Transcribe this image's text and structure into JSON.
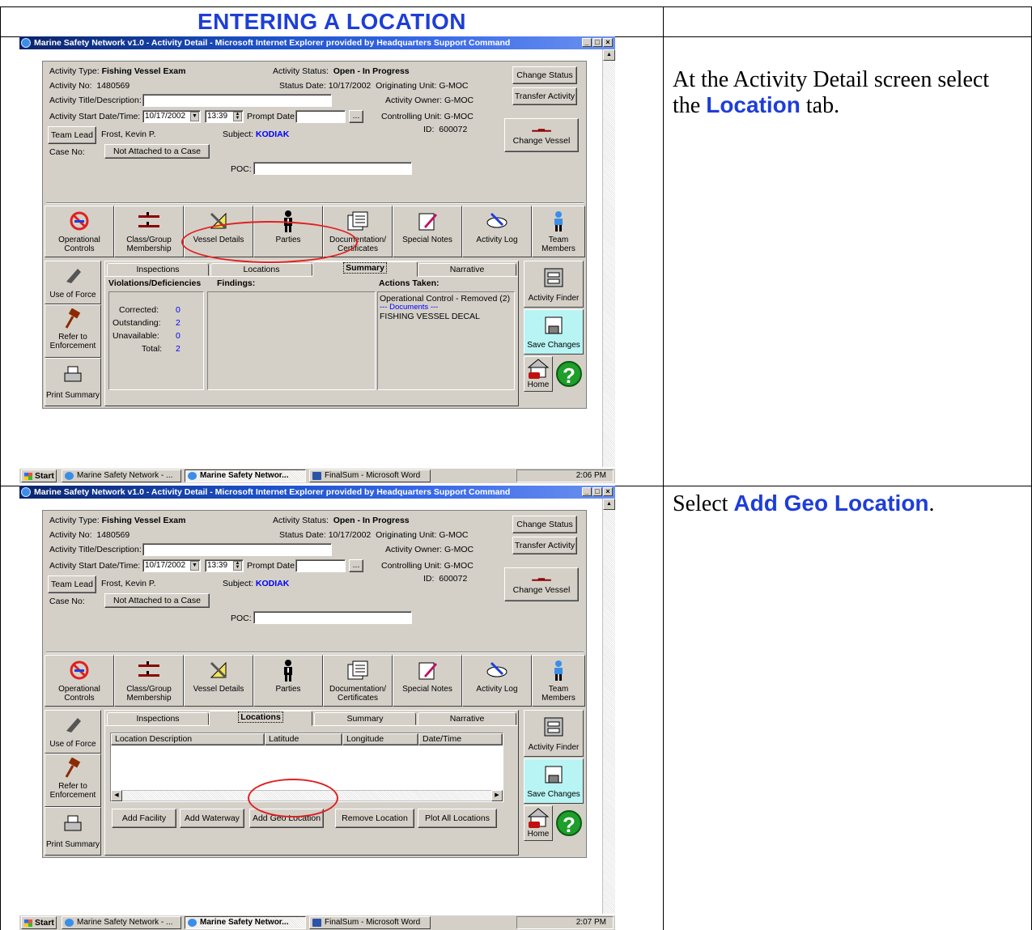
{
  "doc": {
    "header_title": "ENTERING A LOCATION",
    "step1": {
      "pre": "At the Activity Detail screen select the ",
      "highlight": "Location",
      "post": " tab."
    },
    "step2": {
      "pre": "Select ",
      "highlight": "Add Geo Location",
      "post": "."
    }
  },
  "window": {
    "title": "Marine Safety Network v1.0 - Activity Detail - Microsoft Internet Explorer provided by Headquarters Support Command",
    "minimize": "_",
    "maximize": "□",
    "close": "×"
  },
  "form": {
    "activity_type_label": "Activity Type:",
    "activity_type": "Fishing Vessel Exam",
    "activity_no_label": "Activity No:",
    "activity_no": "1480569",
    "title_label": "Activity Title/Description:",
    "title_value": "",
    "start_label": "Activity Start Date/Time:",
    "start_date": "10/17/2002",
    "start_time": "13:39",
    "prompt_label": "Prompt Date:",
    "prompt_value": "",
    "team_lead_button": "Team Lead",
    "team_lead": "Frost, Kevin P.",
    "subject_label": "Subject:",
    "subject": "KODIAK",
    "case_label": "Case No:",
    "case_button": "Not Attached to a Case",
    "poc_label": "POC:",
    "poc_value": "",
    "status_label": "Activity Status:",
    "status": "Open - In Progress",
    "status_date_label": "Status Date:",
    "status_date": "10/17/2002",
    "orig_unit_label": "Originating Unit:",
    "orig_unit": "G-MOC",
    "owner_label": "Activity Owner:",
    "owner": "G-MOC",
    "ctrl_unit_label": "Controlling Unit:",
    "ctrl_unit": "G-MOC",
    "id_label": "ID:",
    "id": "600072",
    "change_status": "Change Status",
    "transfer_activity": "Transfer Activity",
    "change_vessel": "Change Vessel",
    "ellipsis": "..."
  },
  "iconbar": [
    {
      "l1": "Operational",
      "l2": "Controls",
      "icon": "no-entry-icon"
    },
    {
      "l1": "Class/Group",
      "l2": "Membership",
      "icon": "ships-icon"
    },
    {
      "l1": "Vessel Details",
      "l2": "",
      "icon": "tools-icon"
    },
    {
      "l1": "Parties",
      "l2": "",
      "icon": "person-icon"
    },
    {
      "l1": "Documentation/",
      "l2": "Certificates",
      "icon": "documents-icon"
    },
    {
      "l1": "Special Notes",
      "l2": "",
      "icon": "notes-icon"
    },
    {
      "l1": "Activity  Log",
      "l2": "",
      "icon": "log-icon"
    },
    {
      "l1": "Team Members",
      "l2": "",
      "icon": "sailor-icon"
    }
  ],
  "side": {
    "use_of_force": "Use of Force",
    "refer1": "Refer to",
    "refer2": "Enforcement",
    "print_summary": "Print Summary",
    "activity_finder": "Activity Finder",
    "save_changes": "Save Changes",
    "home": "Home",
    "help": "?"
  },
  "tabs": [
    "Inspections",
    "Locations",
    "Summary",
    "Narrative"
  ],
  "summary": {
    "violations_heading": "Violations/Deficiencies",
    "findings_heading": "Findings:",
    "actions_heading": "Actions Taken:",
    "corrected_label": "Corrected:",
    "corrected": "0",
    "outstanding_label": "Outstanding:",
    "outstanding": "2",
    "unavailable_label": "Unavailable:",
    "unavailable": "0",
    "total_label": "Total:",
    "total": "2",
    "action1": "Operational Control - Removed (2)",
    "action2": "--- Documents ---",
    "action3": "FISHING VESSEL DECAL"
  },
  "locations": {
    "columns": [
      "Location Description",
      "Latitude",
      "Longitude",
      "Date/Time"
    ],
    "buttons": [
      "Add Facility",
      "Add Waterway",
      "Add Geo Location",
      "Remove Location",
      "Plot All Locations"
    ]
  },
  "taskbar1": {
    "start": "Start",
    "items": [
      "Marine Safety Network - ...",
      "Marine Safety Networ...",
      "FinalSum - Microsoft Word"
    ],
    "clock": "2:06 PM"
  },
  "taskbar2": {
    "start": "Start",
    "items": [
      "Marine Safety Network - ...",
      "Marine Safety Networ...",
      "FinalSum - Microsoft Word"
    ],
    "clock": "2:07 PM"
  },
  "colors": {
    "accent": "#1e3ed8",
    "highlight_circle": "#e02020",
    "win_face": "#d4d0c8"
  }
}
